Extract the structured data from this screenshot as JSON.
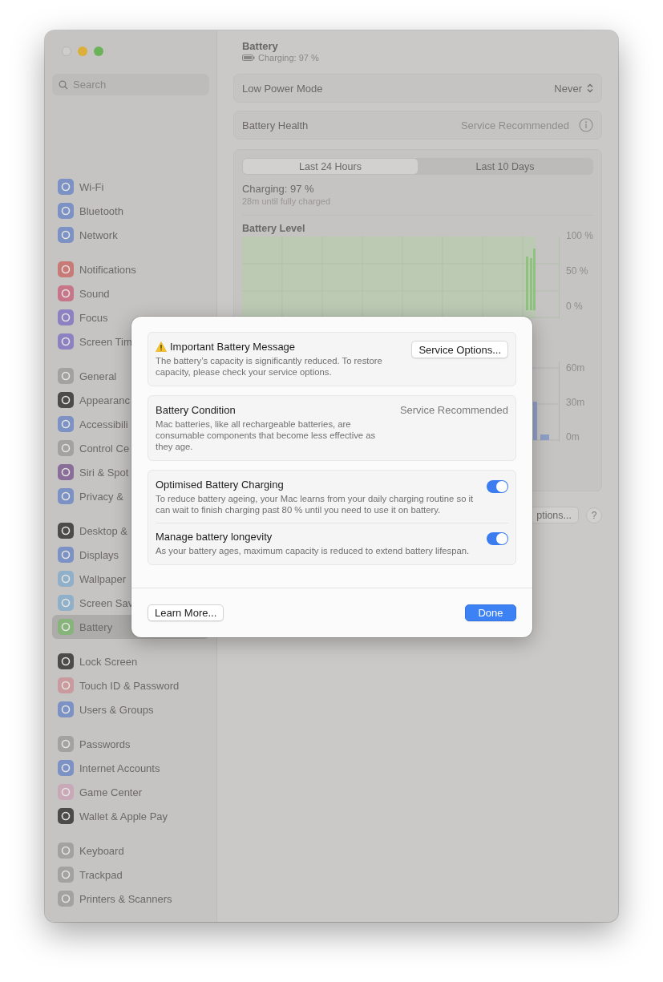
{
  "sidebar": {
    "search": {
      "placeholder": "Search"
    },
    "groups": [
      {
        "items": [
          {
            "label": "Wi-Fi",
            "color": "#7d92c4",
            "selected": false
          },
          {
            "label": "Bluetooth",
            "color": "#7d92c4",
            "selected": false
          },
          {
            "label": "Network",
            "color": "#7d92c4",
            "selected": false
          }
        ]
      },
      {
        "items": [
          {
            "label": "Notifications",
            "color": "#c77a76",
            "selected": false
          },
          {
            "label": "Sound",
            "color": "#c7768a",
            "selected": false
          },
          {
            "label": "Focus",
            "color": "#8c82c2",
            "selected": false
          },
          {
            "label": "Screen Tim",
            "color": "#8c82c2",
            "selected": false
          }
        ]
      },
      {
        "items": [
          {
            "label": "General",
            "color": "#a3a2a2",
            "selected": false
          },
          {
            "label": "Appearanc",
            "color": "#4c4b4b",
            "selected": false
          },
          {
            "label": "Accessibili",
            "color": "#7d92c4",
            "selected": false
          },
          {
            "label": "Control Ce",
            "color": "#a3a2a2",
            "selected": false
          },
          {
            "label": "Siri & Spot",
            "color": "#8a6e9a",
            "selected": false
          },
          {
            "label": "Privacy &",
            "color": "#7d92c4",
            "selected": false
          }
        ]
      },
      {
        "items": [
          {
            "label": "Desktop &",
            "color": "#4c4b4b",
            "selected": false
          },
          {
            "label": "Displays",
            "color": "#7d92c4",
            "selected": false
          },
          {
            "label": "Wallpaper",
            "color": "#8fb0c8",
            "selected": false
          },
          {
            "label": "Screen Sav",
            "color": "#8fb0c8",
            "selected": false
          },
          {
            "label": "Battery",
            "color": "#86b47a",
            "selected": true
          }
        ]
      },
      {
        "items": [
          {
            "label": "Lock Screen",
            "color": "#4c4b4b",
            "selected": false
          },
          {
            "label": "Touch ID & Password",
            "color": "#c99a9e",
            "selected": false
          },
          {
            "label": "Users & Groups",
            "color": "#7d92c4",
            "selected": false
          }
        ]
      },
      {
        "items": [
          {
            "label": "Passwords",
            "color": "#a3a2a2",
            "selected": false
          },
          {
            "label": "Internet Accounts",
            "color": "#7d92c4",
            "selected": false
          },
          {
            "label": "Game Center",
            "color": "#c9a8b8",
            "selected": false
          },
          {
            "label": "Wallet & Apple Pay",
            "color": "#4c4b4b",
            "selected": false
          }
        ]
      },
      {
        "items": [
          {
            "label": "Keyboard",
            "color": "#a3a2a2",
            "selected": false
          },
          {
            "label": "Trackpad",
            "color": "#a3a2a2",
            "selected": false
          },
          {
            "label": "Printers & Scanners",
            "color": "#a3a2a2",
            "selected": false
          }
        ]
      }
    ]
  },
  "header": {
    "title": "Battery",
    "subtitle": "Charging: 97 %"
  },
  "settings_rows": [
    {
      "label": "Low Power Mode",
      "value": "Never",
      "kind": "popup"
    },
    {
      "label": "Battery Health",
      "value": "Service Recommended",
      "kind": "info"
    }
  ],
  "usage": {
    "tabs": [
      {
        "label": "Last 24 Hours",
        "selected": true
      },
      {
        "label": "Last 10 Days",
        "selected": false
      }
    ],
    "status": "Charging: 97 %",
    "detail": "28m until fully charged",
    "battery_level": {
      "title": "Battery Level",
      "y_ticks": [
        "100 %",
        "50 %",
        "0 %"
      ]
    },
    "usage_chart": {
      "y_ticks": [
        "60m",
        "30m",
        "0m"
      ]
    }
  },
  "footer_buttons": [
    {
      "label": "ptions...",
      "kind": "text"
    },
    {
      "label": "?",
      "kind": "help"
    }
  ],
  "dialog": {
    "sections": [
      {
        "kind": "warning",
        "title": "Important Battery Message",
        "text": "The battery’s capacity is significantly reduced. To restore capacity, please check your service options.",
        "button": "Service Options..."
      },
      {
        "kind": "status",
        "title": "Battery Condition",
        "text": "Mac batteries, like all rechargeable batteries, are consumable components that become less effective as they age.",
        "value": "Service Recommended"
      },
      {
        "kind": "toggles",
        "items": [
          {
            "title": "Optimised Battery Charging",
            "text": "To reduce battery ageing, your Mac learns from your daily charging routine so it can wait to finish charging past 80 % until you need to use it on battery.",
            "on": true
          },
          {
            "title": "Manage battery longevity",
            "text": "As your battery ages, maximum capacity is reduced to extend battery lifespan.",
            "on": true
          }
        ]
      }
    ],
    "buttons": [
      {
        "label": "Learn More...",
        "kind": "secondary"
      },
      {
        "label": "Done",
        "kind": "primary"
      }
    ]
  }
}
